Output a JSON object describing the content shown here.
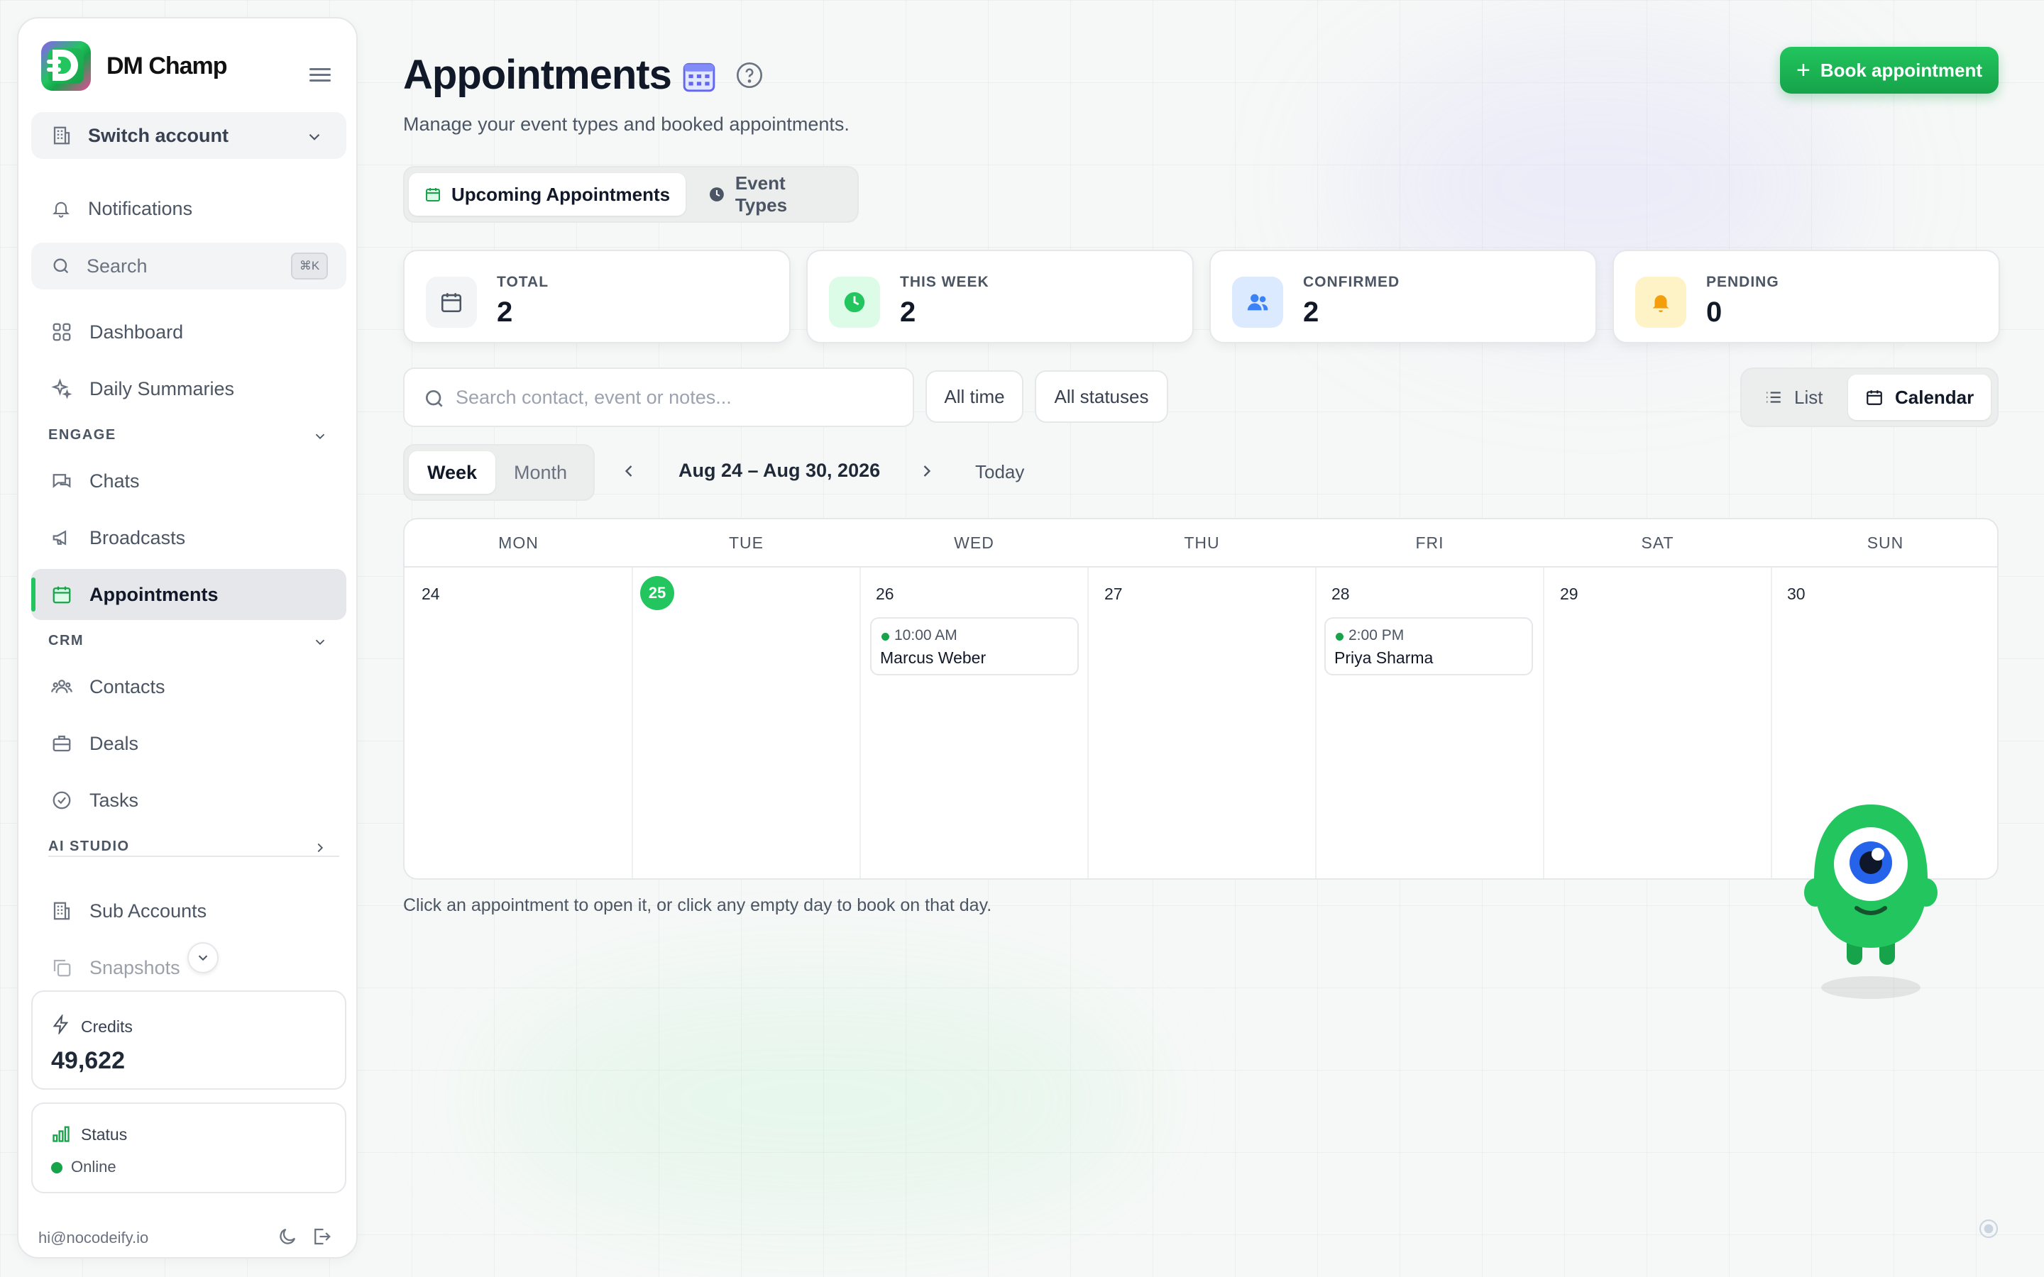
{
  "brand": {
    "name": "DM Champ"
  },
  "sidebar": {
    "switch_account": "Switch account",
    "notifications": "Notifications",
    "search_label": "Search",
    "search_shortcut": "⌘K",
    "dashboard": "Dashboard",
    "daily_summaries": "Daily Summaries",
    "section_engage": "ENGAGE",
    "chats": "Chats",
    "broadcasts": "Broadcasts",
    "appointments": "Appointments",
    "section_crm": "CRM",
    "contacts": "Contacts",
    "deals": "Deals",
    "tasks": "Tasks",
    "section_ai_studio": "AI STUDIO",
    "sub_accounts": "Sub Accounts",
    "snapshots": "Snapshots",
    "credits_label": "Credits",
    "credits_value": "49,622",
    "status_label": "Status",
    "status_value": "Online",
    "email": "hi@nocodeify.io"
  },
  "header": {
    "title": "Appointments",
    "subtitle": "Manage your event types and booked appointments.",
    "book_button": "Book appointment"
  },
  "tabs": [
    {
      "label": "Upcoming Appointments",
      "active": true
    },
    {
      "label": "Event Types",
      "active": false
    }
  ],
  "stats": [
    {
      "label": "TOTAL",
      "value": "2"
    },
    {
      "label": "THIS WEEK",
      "value": "2"
    },
    {
      "label": "CONFIRMED",
      "value": "2"
    },
    {
      "label": "PENDING",
      "value": "0"
    }
  ],
  "filters": {
    "search_placeholder": "Search contact, event or notes...",
    "time": "All time",
    "status": "All statuses",
    "view_list": "List",
    "view_calendar": "Calendar"
  },
  "calendar": {
    "mode_week": "Week",
    "mode_month": "Month",
    "range": "Aug 24 – Aug 30, 2026",
    "today": "Today",
    "days": [
      {
        "dow": "MON",
        "num": "24"
      },
      {
        "dow": "TUE",
        "num": "25"
      },
      {
        "dow": "WED",
        "num": "26"
      },
      {
        "dow": "THU",
        "num": "27"
      },
      {
        "dow": "FRI",
        "num": "28"
      },
      {
        "dow": "SAT",
        "num": "29"
      },
      {
        "dow": "SUN",
        "num": "30"
      }
    ],
    "appointments": [
      {
        "time": "10:00 AM",
        "name": "Marcus Weber"
      },
      {
        "time": "2:00 PM",
        "name": "Priya Sharma"
      }
    ],
    "hint": "Click an appointment to open it, or click any empty day to book on that day."
  },
  "colors": {
    "accent": "#22c55e",
    "accent_dark": "#16a34a",
    "confirmed_blue": "#3b82f6",
    "pending_amber": "#f59e0b"
  }
}
